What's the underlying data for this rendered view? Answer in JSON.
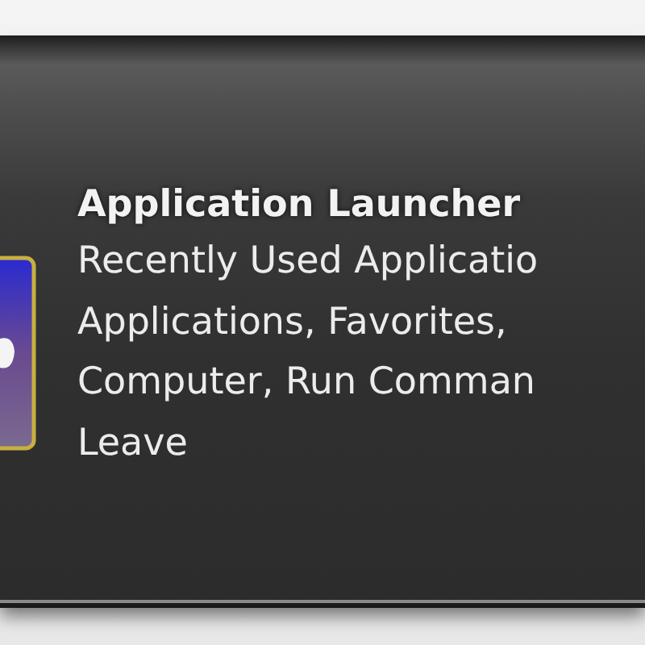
{
  "tooltip": {
    "title": "Application Launcher",
    "lines": [
      "Recently Used Applicatio",
      "Applications, Favorites,",
      "Computer, Run Comman",
      "Leave"
    ]
  }
}
